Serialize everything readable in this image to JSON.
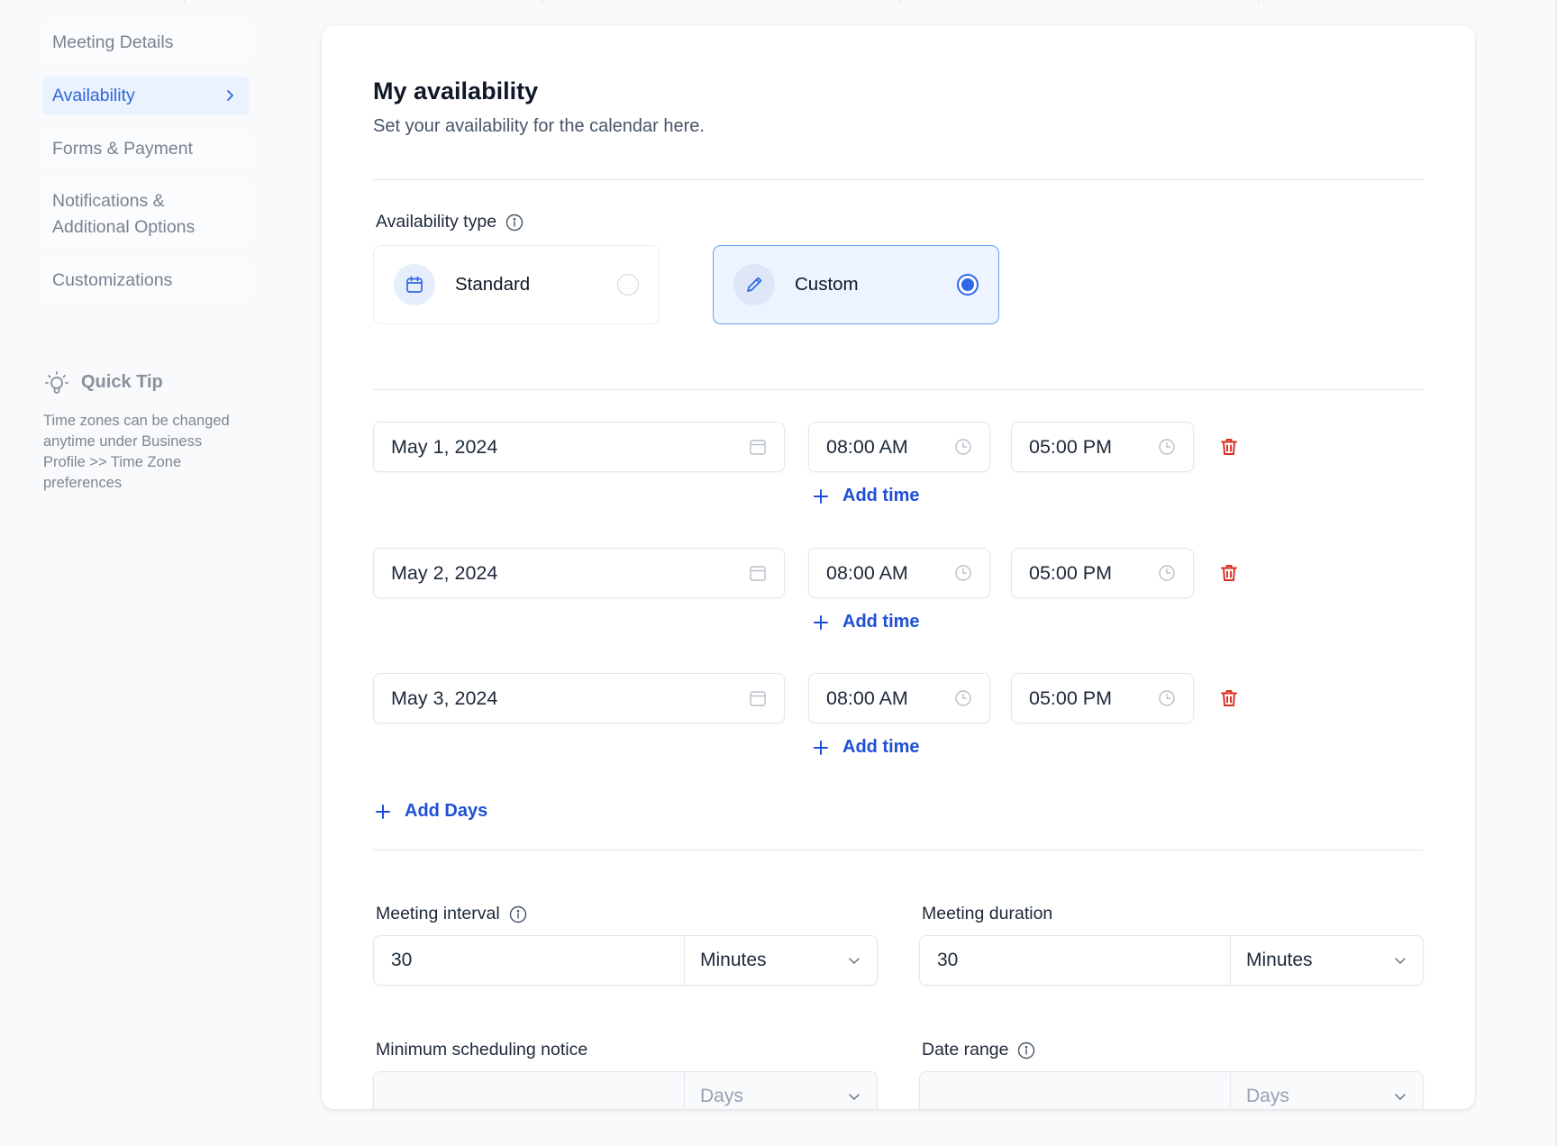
{
  "sidebar": {
    "items": [
      {
        "label": "Meeting Details",
        "active": false
      },
      {
        "label": "Availability",
        "active": true
      },
      {
        "label": "Forms & Payment",
        "active": false
      },
      {
        "label": "Notifications &\nAdditional Options",
        "active": false
      },
      {
        "label": "Customizations",
        "active": false
      }
    ],
    "tip": {
      "icon": "lightbulb-icon",
      "title": "Quick Tip",
      "body": "Time zones can be changed anytime under Business Profile >> Time Zone preferences"
    }
  },
  "main": {
    "title": "My availability",
    "subtitle": "Set your availability for the calendar here.",
    "availability_type": {
      "label": "Availability type",
      "options": [
        {
          "label": "Standard",
          "icon": "calendar-icon",
          "selected": false
        },
        {
          "label": "Custom",
          "icon": "pencil-icon",
          "selected": true
        }
      ]
    },
    "days": [
      {
        "date": "May 1, 2024",
        "start": "08:00 AM",
        "end": "05:00 PM",
        "add_time": "Add time"
      },
      {
        "date": "May 2, 2024",
        "start": "08:00 AM",
        "end": "05:00 PM",
        "add_time": "Add time"
      },
      {
        "date": "May 3, 2024",
        "start": "08:00 AM",
        "end": "05:00 PM",
        "add_time": "Add time"
      }
    ],
    "add_days": "Add Days",
    "meeting_interval": {
      "label": "Meeting interval",
      "value": "30",
      "unit": "Minutes"
    },
    "meeting_duration": {
      "label": "Meeting duration",
      "value": "30",
      "unit": "Minutes"
    },
    "min_notice": {
      "label": "Minimum scheduling notice",
      "value": "",
      "unit": "Days"
    },
    "date_range": {
      "label": "Date range",
      "value": "",
      "unit": "Days"
    }
  },
  "colors": {
    "accent": "#2f67e6",
    "link": "#1e4fd6",
    "danger": "#d92d20",
    "selected_bg": "#eef4ff"
  }
}
